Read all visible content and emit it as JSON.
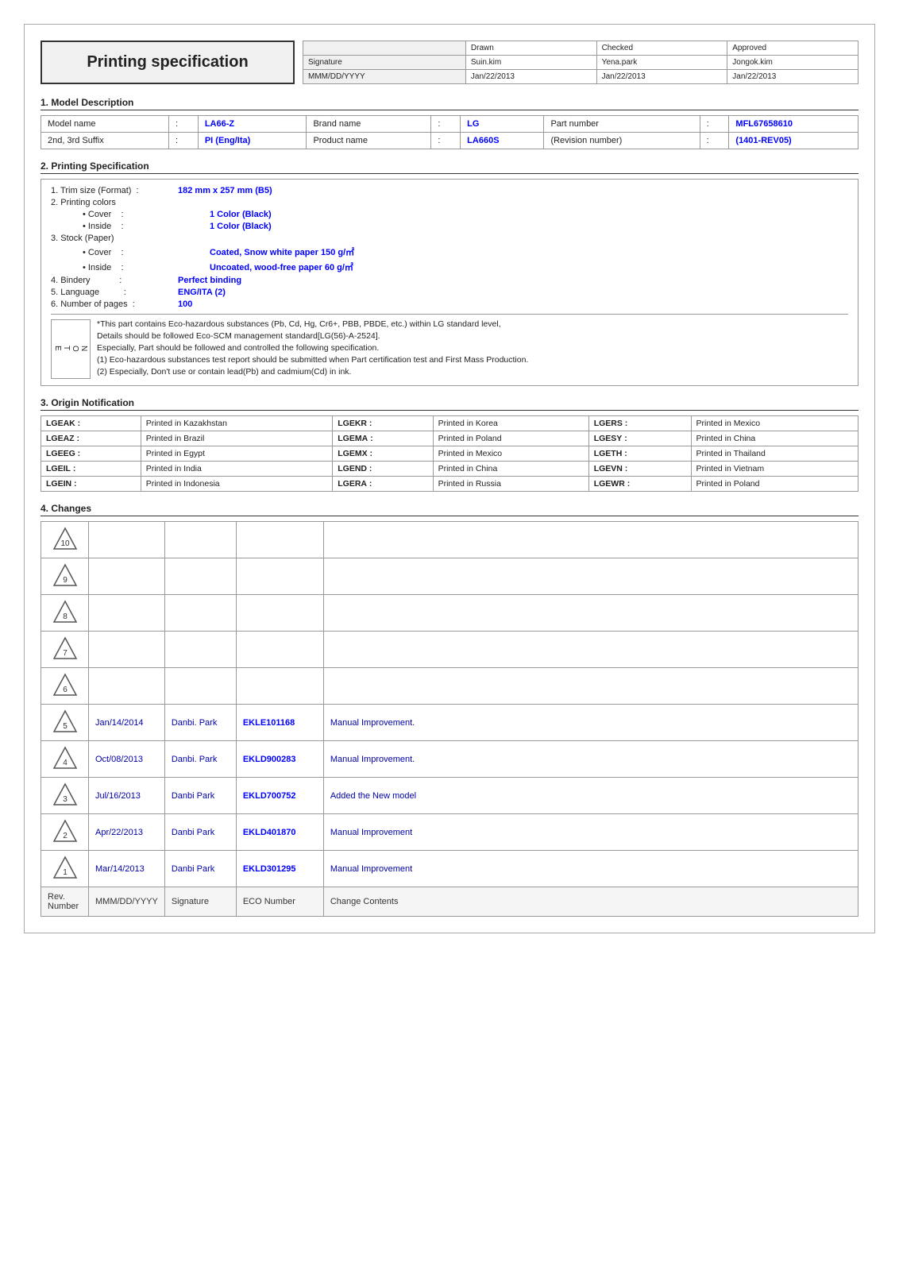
{
  "header": {
    "title": "Printing specification",
    "approval": {
      "columns": [
        "",
        "Drawn",
        "Checked",
        "Approved"
      ],
      "rows": [
        [
          "Signature",
          "Suin.kim",
          "Yena.park",
          "Jongok.kim"
        ],
        [
          "MMM/DD/YYYY",
          "Jan/22/2013",
          "Jan/22/2013",
          "Jan/22/2013"
        ]
      ]
    }
  },
  "section1": {
    "title": "1. Model Description",
    "rows": [
      {
        "label": "Model name",
        "value": "LA66-Z",
        "label2": "Brand name",
        "value2": "LG",
        "label3": "Part number",
        "value3": "MFL67658610"
      },
      {
        "label": "2nd, 3rd Suffix",
        "value": "PI (Eng/Ita)",
        "label2": "Product name",
        "value2": "LA660S",
        "label3": "(Revision number)",
        "value3": "(1401-REV05)"
      }
    ]
  },
  "section2": {
    "title": "2. Printing Specification",
    "items": [
      {
        "num": "1.",
        "label": "Trim size (Format)",
        "value": "182 mm x 257 mm (B5)"
      },
      {
        "num": "2.",
        "label": "Printing colors",
        "value": ""
      },
      {
        "num": "",
        "label": "• Cover",
        "value": "1 Color (Black)"
      },
      {
        "num": "",
        "label": "• Inside",
        "value": "1 Color (Black)"
      },
      {
        "num": "3.",
        "label": "Stock (Paper)",
        "value": ""
      },
      {
        "num": "",
        "label": "• Cover",
        "value": "Coated, Snow white paper 150 g/㎡"
      },
      {
        "num": "",
        "label": "• Inside",
        "value": "Uncoated, wood-free paper 60 g/㎡"
      },
      {
        "num": "4.",
        "label": "Bindery",
        "value": "Perfect binding"
      },
      {
        "num": "5.",
        "label": "Language",
        "value": "ENG/ITA (2)"
      },
      {
        "num": "6.",
        "label": "Number of pages",
        "value": "100"
      }
    ],
    "notes": {
      "sidebar": "NOTE",
      "lines": [
        "*This part contains Eco-hazardous substances (Pb, Cd, Hg, Cr6+, PBB, PBDE, etc.) within LG standard level,",
        "Details should be followed Eco-SCM management standard[LG(56)-A-2524].",
        "Especially, Part should be followed and controlled the following specification.",
        "(1) Eco-hazardous substances test report should be submitted when Part certification test and First Mass Production.",
        "(2) Especially, Don't use or contain lead(Pb) and cadmium(Cd) in ink."
      ]
    }
  },
  "section3": {
    "title": "3. Origin Notification",
    "rows": [
      [
        {
          "code": "LGEAK",
          "text": "Printed in Kazakhstan"
        },
        {
          "code": "LGEKR",
          "text": "Printed in Korea"
        },
        {
          "code": "LGERS",
          "text": "Printed in Mexico"
        }
      ],
      [
        {
          "code": "LGEAZ",
          "text": "Printed in Brazil"
        },
        {
          "code": "LGEMA",
          "text": "Printed in Poland"
        },
        {
          "code": "LGESY",
          "text": "Printed in China"
        }
      ],
      [
        {
          "code": "LGEEG",
          "text": "Printed in Egypt"
        },
        {
          "code": "LGEMX",
          "text": "Printed in Mexico"
        },
        {
          "code": "LGETH",
          "text": "Printed in Thailand"
        }
      ],
      [
        {
          "code": "LGEIL",
          "text": "Printed in India"
        },
        {
          "code": "LGEND",
          "text": "Printed in China"
        },
        {
          "code": "LGEVN",
          "text": "Printed in Vietnam"
        }
      ],
      [
        {
          "code": "LGEIN",
          "text": "Printed in Indonesia"
        },
        {
          "code": "LGERA",
          "text": "Printed in Russia"
        },
        {
          "code": "LGEWR",
          "text": "Printed in Poland"
        }
      ]
    ]
  },
  "section4": {
    "title": "4. Changes",
    "header": {
      "rev": "Rev. Number",
      "date": "MMM/DD/YYYY",
      "sig": "Signature",
      "eco": "ECO Number",
      "change": "Change Contents"
    },
    "rows": [
      {
        "rev": "10",
        "date": "",
        "sig": "",
        "eco": "",
        "change": ""
      },
      {
        "rev": "9",
        "date": "",
        "sig": "",
        "eco": "",
        "change": ""
      },
      {
        "rev": "8",
        "date": "",
        "sig": "",
        "eco": "",
        "change": ""
      },
      {
        "rev": "7",
        "date": "",
        "sig": "",
        "eco": "",
        "change": ""
      },
      {
        "rev": "6",
        "date": "",
        "sig": "",
        "eco": "",
        "change": ""
      },
      {
        "rev": "5",
        "date": "Jan/14/2014",
        "sig": "Danbi. Park",
        "eco": "EKLE101168",
        "change": "Manual Improvement."
      },
      {
        "rev": "4",
        "date": "Oct/08/2013",
        "sig": "Danbi. Park",
        "eco": "EKLD900283",
        "change": "Manual Improvement."
      },
      {
        "rev": "3",
        "date": "Jul/16/2013",
        "sig": "Danbi Park",
        "eco": "EKLD700752",
        "change": "Added the New model"
      },
      {
        "rev": "2",
        "date": "Apr/22/2013",
        "sig": "Danbi Park",
        "eco": "EKLD401870",
        "change": "Manual Improvement"
      },
      {
        "rev": "1",
        "date": "Mar/14/2013",
        "sig": "Danbi Park",
        "eco": "EKLD301295",
        "change": "Manual Improvement"
      }
    ]
  }
}
